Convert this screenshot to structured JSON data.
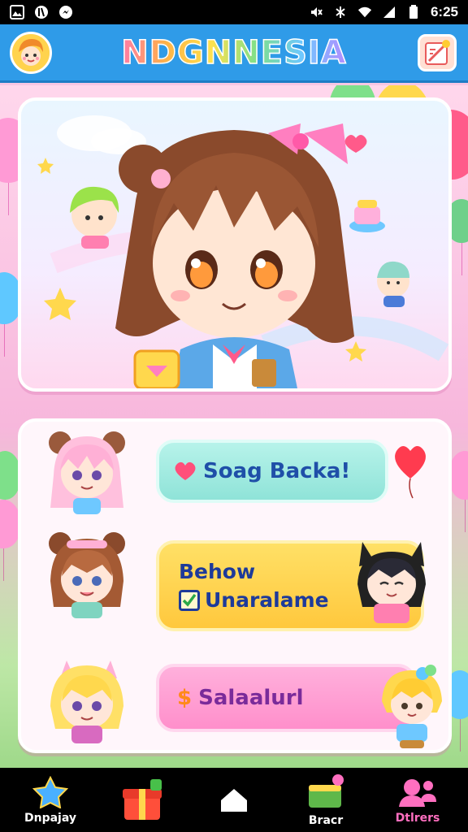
{
  "status_bar": {
    "time": "6:25",
    "left_icons": [
      "image-icon",
      "nfc-icon",
      "messenger-icon"
    ],
    "right_icons": [
      "mute-icon",
      "signal-icon",
      "wifi-icon",
      "cell-icon",
      "battery-icon"
    ]
  },
  "header": {
    "title": "NDGNNESIA",
    "avatar_icon": "chibi-avatar-icon",
    "edit_icon": "edit-note-icon"
  },
  "menu": {
    "item1_label": "Soag Backa!",
    "item2_line1": "Behow",
    "item2_line2": "Unaralame",
    "item3_label": "Salaalurl",
    "item3_prefix": "$"
  },
  "bottom_nav": {
    "items": [
      {
        "label": "Dnpajay",
        "icon": "star-icon"
      },
      {
        "label": "",
        "icon": "gift-box-icon"
      },
      {
        "label": "",
        "icon": "home-icon"
      },
      {
        "label": "Bracr",
        "icon": "cake-icon"
      },
      {
        "label": "Dtlrers",
        "icon": "people-icon"
      }
    ]
  },
  "colors": {
    "header": "#2f9be8",
    "accent_pink": "#ff6fc0",
    "pill_teal": "#9fe9df",
    "pill_yellow": "#ffd34d",
    "pill_pink": "#ffa0d4"
  }
}
